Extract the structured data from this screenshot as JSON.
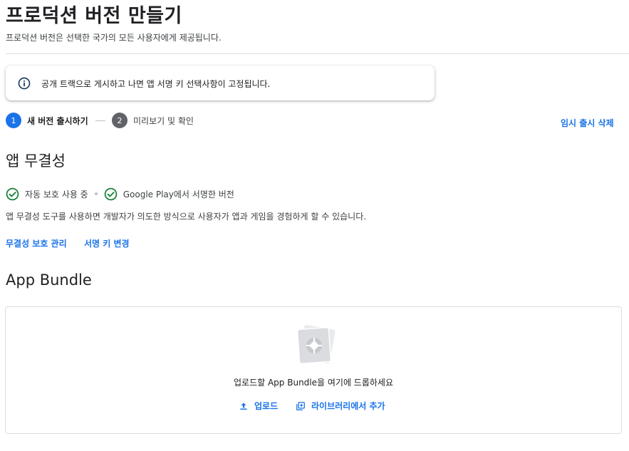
{
  "header": {
    "title": "프로덕션 버전 만들기",
    "subtitle": "프로덕션 버전은 선택한 국가의 모든 사용자에게 제공됩니다."
  },
  "info_banner": {
    "icon": "info-icon",
    "text": "공개 트랙으로 게시하고 나면 앱 서명 키 선택사항이 고정됩니다."
  },
  "stepper": {
    "steps": [
      {
        "number": "1",
        "label": "새 버전 출시하기",
        "state": "active"
      },
      {
        "number": "2",
        "label": "미리보기 및 확인",
        "state": "inactive"
      }
    ],
    "delete_link": "임시 출시 삭제"
  },
  "app_integrity": {
    "title": "앱 무결성",
    "statuses": [
      {
        "icon": "check-circle-icon",
        "label": "자동 보호 사용 중"
      },
      {
        "icon": "check-circle-icon",
        "label": "Google Play에서 서명한 버전"
      }
    ],
    "description": "앱 무결성 도구를 사용하면 개발자가 의도한 방식으로 사용자가 앱과 게임을 경험하게 할 수 있습니다.",
    "links": {
      "manage": "무결성 보호 관리",
      "change_key": "서명 키 변경"
    }
  },
  "app_bundle": {
    "title": "App Bundle",
    "drop_text": "업로드할 App Bundle을 여기에 드롭하세요",
    "upload_label": "업로드",
    "library_label": "라이브러리에서 추가"
  },
  "colors": {
    "accent": "#1a73e8",
    "success": "#188038",
    "text": "#202124",
    "secondary_text": "#3c4043",
    "step_inactive": "#5f6368",
    "border": "#dadce0"
  }
}
